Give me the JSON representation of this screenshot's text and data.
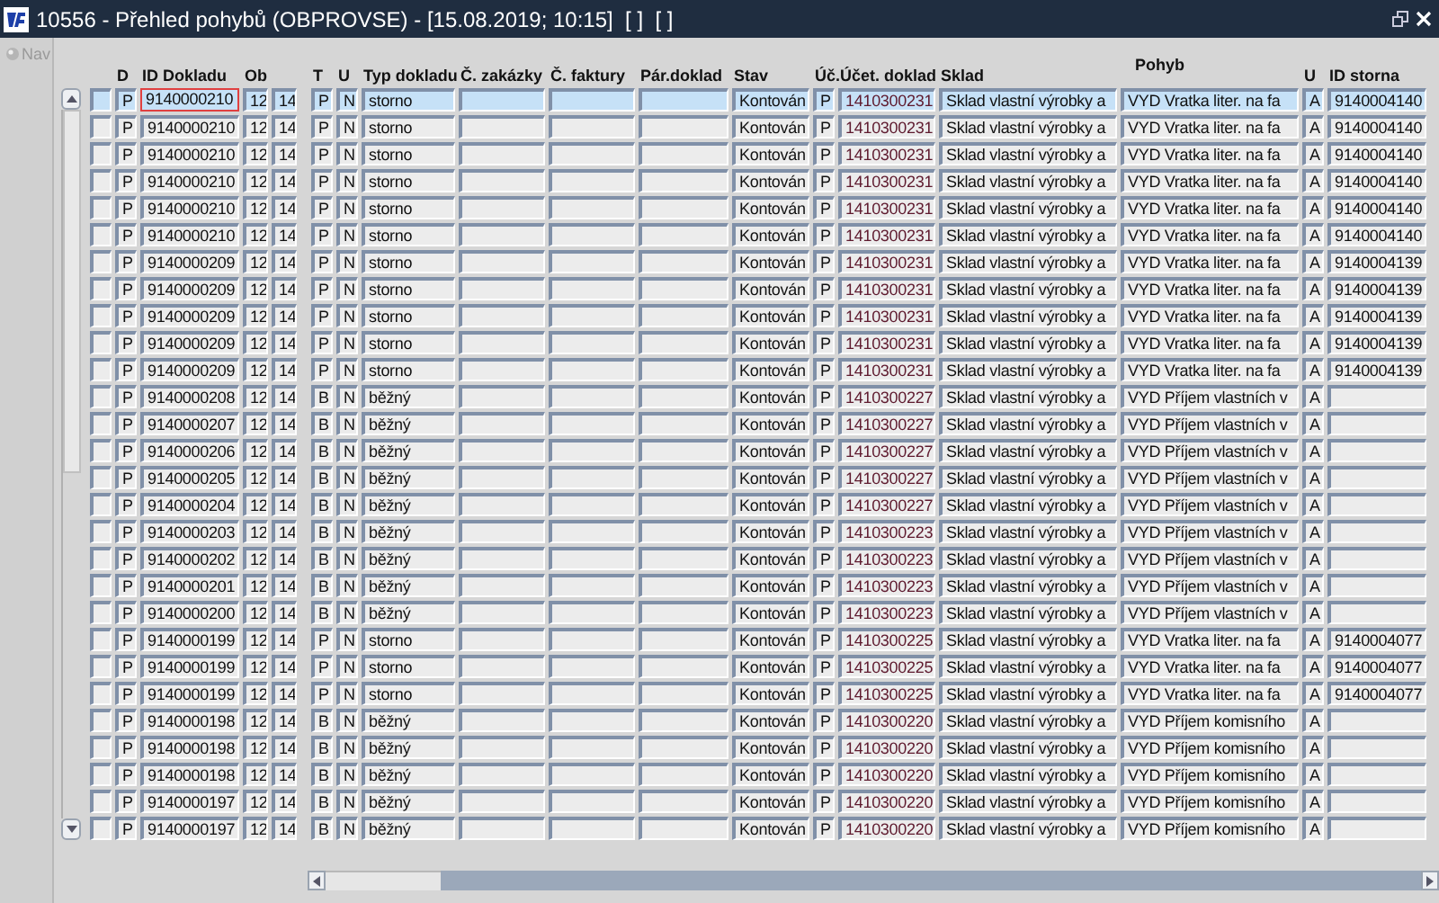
{
  "window": {
    "title": "10556 - Přehled pohybů (OBPROVSE) - [15.08.2019; 10:15]  [ ]  [ ]"
  },
  "nav": {
    "label": "Nav",
    "disabled": true
  },
  "table": {
    "columns": [
      null,
      "D",
      "ID Dokladu",
      "Ob",
      null,
      "T",
      "U",
      "Typ dokladu",
      "Č. zakázky",
      "Č. faktury",
      "Pár.doklad",
      "Stav",
      "Úč.",
      "Účet. doklad",
      "Sklad",
      "Pohyb",
      "U",
      "ID storna"
    ],
    "rows": [
      {
        "selected": true,
        "cells": [
          null,
          "P",
          "9140000210",
          "12",
          "14",
          "P",
          "N",
          "storno",
          null,
          null,
          null,
          "Kontován",
          "P",
          "1410300231",
          "Sklad vlastní výrobky a",
          "VYD Vratka liter. na fa",
          "A",
          "9140004140"
        ]
      },
      {
        "selected": false,
        "cells": [
          null,
          "P",
          "9140000210",
          "12",
          "14",
          "P",
          "N",
          "storno",
          null,
          null,
          null,
          "Kontován",
          "P",
          "1410300231",
          "Sklad vlastní výrobky a",
          "VYD Vratka liter. na fa",
          "A",
          "9140004140"
        ]
      },
      {
        "selected": false,
        "cells": [
          null,
          "P",
          "9140000210",
          "12",
          "14",
          "P",
          "N",
          "storno",
          null,
          null,
          null,
          "Kontován",
          "P",
          "1410300231",
          "Sklad vlastní výrobky a",
          "VYD Vratka liter. na fa",
          "A",
          "9140004140"
        ]
      },
      {
        "selected": false,
        "cells": [
          null,
          "P",
          "9140000210",
          "12",
          "14",
          "P",
          "N",
          "storno",
          null,
          null,
          null,
          "Kontován",
          "P",
          "1410300231",
          "Sklad vlastní výrobky a",
          "VYD Vratka liter. na fa",
          "A",
          "9140004140"
        ]
      },
      {
        "selected": false,
        "cells": [
          null,
          "P",
          "9140000210",
          "12",
          "14",
          "P",
          "N",
          "storno",
          null,
          null,
          null,
          "Kontován",
          "P",
          "1410300231",
          "Sklad vlastní výrobky a",
          "VYD Vratka liter. na fa",
          "A",
          "9140004140"
        ]
      },
      {
        "selected": false,
        "cells": [
          null,
          "P",
          "9140000210",
          "12",
          "14",
          "P",
          "N",
          "storno",
          null,
          null,
          null,
          "Kontován",
          "P",
          "1410300231",
          "Sklad vlastní výrobky a",
          "VYD Vratka liter. na fa",
          "A",
          "9140004140"
        ]
      },
      {
        "selected": false,
        "cells": [
          null,
          "P",
          "9140000209",
          "12",
          "14",
          "P",
          "N",
          "storno",
          null,
          null,
          null,
          "Kontován",
          "P",
          "1410300231",
          "Sklad vlastní výrobky a",
          "VYD Vratka liter. na fa",
          "A",
          "9140004139"
        ]
      },
      {
        "selected": false,
        "cells": [
          null,
          "P",
          "9140000209",
          "12",
          "14",
          "P",
          "N",
          "storno",
          null,
          null,
          null,
          "Kontován",
          "P",
          "1410300231",
          "Sklad vlastní výrobky a",
          "VYD Vratka liter. na fa",
          "A",
          "9140004139"
        ]
      },
      {
        "selected": false,
        "cells": [
          null,
          "P",
          "9140000209",
          "12",
          "14",
          "P",
          "N",
          "storno",
          null,
          null,
          null,
          "Kontován",
          "P",
          "1410300231",
          "Sklad vlastní výrobky a",
          "VYD Vratka liter. na fa",
          "A",
          "9140004139"
        ]
      },
      {
        "selected": false,
        "cells": [
          null,
          "P",
          "9140000209",
          "12",
          "14",
          "P",
          "N",
          "storno",
          null,
          null,
          null,
          "Kontován",
          "P",
          "1410300231",
          "Sklad vlastní výrobky a",
          "VYD Vratka liter. na fa",
          "A",
          "9140004139"
        ]
      },
      {
        "selected": false,
        "cells": [
          null,
          "P",
          "9140000209",
          "12",
          "14",
          "P",
          "N",
          "storno",
          null,
          null,
          null,
          "Kontován",
          "P",
          "1410300231",
          "Sklad vlastní výrobky a",
          "VYD Vratka liter. na fa",
          "A",
          "9140004139"
        ]
      },
      {
        "selected": false,
        "cells": [
          null,
          "P",
          "9140000208",
          "12",
          "14",
          "B",
          "N",
          "běžný",
          null,
          null,
          null,
          "Kontován",
          "P",
          "1410300227",
          "Sklad vlastní výrobky a",
          "VYD Příjem vlastních v",
          "A",
          null
        ]
      },
      {
        "selected": false,
        "cells": [
          null,
          "P",
          "9140000207",
          "12",
          "14",
          "B",
          "N",
          "běžný",
          null,
          null,
          null,
          "Kontován",
          "P",
          "1410300227",
          "Sklad vlastní výrobky a",
          "VYD Příjem vlastních v",
          "A",
          null
        ]
      },
      {
        "selected": false,
        "cells": [
          null,
          "P",
          "9140000206",
          "12",
          "14",
          "B",
          "N",
          "běžný",
          null,
          null,
          null,
          "Kontován",
          "P",
          "1410300227",
          "Sklad vlastní výrobky a",
          "VYD Příjem vlastních v",
          "A",
          null
        ]
      },
      {
        "selected": false,
        "cells": [
          null,
          "P",
          "9140000205",
          "12",
          "14",
          "B",
          "N",
          "běžný",
          null,
          null,
          null,
          "Kontován",
          "P",
          "1410300227",
          "Sklad vlastní výrobky a",
          "VYD Příjem vlastních v",
          "A",
          null
        ]
      },
      {
        "selected": false,
        "cells": [
          null,
          "P",
          "9140000204",
          "12",
          "14",
          "B",
          "N",
          "běžný",
          null,
          null,
          null,
          "Kontován",
          "P",
          "1410300227",
          "Sklad vlastní výrobky a",
          "VYD Příjem vlastních v",
          "A",
          null
        ]
      },
      {
        "selected": false,
        "cells": [
          null,
          "P",
          "9140000203",
          "12",
          "14",
          "B",
          "N",
          "běžný",
          null,
          null,
          null,
          "Kontován",
          "P",
          "1410300223",
          "Sklad vlastní výrobky a",
          "VYD Příjem vlastních v",
          "A",
          null
        ]
      },
      {
        "selected": false,
        "cells": [
          null,
          "P",
          "9140000202",
          "12",
          "14",
          "B",
          "N",
          "běžný",
          null,
          null,
          null,
          "Kontován",
          "P",
          "1410300223",
          "Sklad vlastní výrobky a",
          "VYD Příjem vlastních v",
          "A",
          null
        ]
      },
      {
        "selected": false,
        "cells": [
          null,
          "P",
          "9140000201",
          "12",
          "14",
          "B",
          "N",
          "běžný",
          null,
          null,
          null,
          "Kontován",
          "P",
          "1410300223",
          "Sklad vlastní výrobky a",
          "VYD Příjem vlastních v",
          "A",
          null
        ]
      },
      {
        "selected": false,
        "cells": [
          null,
          "P",
          "9140000200",
          "12",
          "14",
          "B",
          "N",
          "běžný",
          null,
          null,
          null,
          "Kontován",
          "P",
          "1410300223",
          "Sklad vlastní výrobky a",
          "VYD Příjem vlastních v",
          "A",
          null
        ]
      },
      {
        "selected": false,
        "cells": [
          null,
          "P",
          "9140000199",
          "12",
          "14",
          "P",
          "N",
          "storno",
          null,
          null,
          null,
          "Kontován",
          "P",
          "1410300225",
          "Sklad vlastní výrobky a",
          "VYD Vratka liter. na fa",
          "A",
          "9140004077"
        ]
      },
      {
        "selected": false,
        "cells": [
          null,
          "P",
          "9140000199",
          "12",
          "14",
          "P",
          "N",
          "storno",
          null,
          null,
          null,
          "Kontován",
          "P",
          "1410300225",
          "Sklad vlastní výrobky a",
          "VYD Vratka liter. na fa",
          "A",
          "9140004077"
        ]
      },
      {
        "selected": false,
        "cells": [
          null,
          "P",
          "9140000199",
          "12",
          "14",
          "P",
          "N",
          "storno",
          null,
          null,
          null,
          "Kontován",
          "P",
          "1410300225",
          "Sklad vlastní výrobky a",
          "VYD Vratka liter. na fa",
          "A",
          "9140004077"
        ]
      },
      {
        "selected": false,
        "cells": [
          null,
          "P",
          "9140000198",
          "12",
          "14",
          "B",
          "N",
          "běžný",
          null,
          null,
          null,
          "Kontován",
          "P",
          "1410300220",
          "Sklad vlastní výrobky a",
          "VYD Příjem komisního",
          "A",
          null
        ]
      },
      {
        "selected": false,
        "cells": [
          null,
          "P",
          "9140000198",
          "12",
          "14",
          "B",
          "N",
          "běžný",
          null,
          null,
          null,
          "Kontován",
          "P",
          "1410300220",
          "Sklad vlastní výrobky a",
          "VYD Příjem komisního",
          "A",
          null
        ]
      },
      {
        "selected": false,
        "cells": [
          null,
          "P",
          "9140000198",
          "12",
          "14",
          "B",
          "N",
          "běžný",
          null,
          null,
          null,
          "Kontován",
          "P",
          "1410300220",
          "Sklad vlastní výrobky a",
          "VYD Příjem komisního",
          "A",
          null
        ]
      },
      {
        "selected": false,
        "cells": [
          null,
          "P",
          "9140000197",
          "12",
          "14",
          "B",
          "N",
          "běžný",
          null,
          null,
          null,
          "Kontován",
          "P",
          "1410300220",
          "Sklad vlastní výrobky a",
          "VYD Příjem komisního",
          "A",
          null
        ]
      },
      {
        "selected": false,
        "cells": [
          null,
          "P",
          "9140000197",
          "12",
          "14",
          "B",
          "N",
          "běžný",
          null,
          null,
          null,
          "Kontován",
          "P",
          "1410300220",
          "Sklad vlastní výrobky a",
          "VYD Příjem komisního",
          "A",
          null
        ]
      }
    ]
  }
}
